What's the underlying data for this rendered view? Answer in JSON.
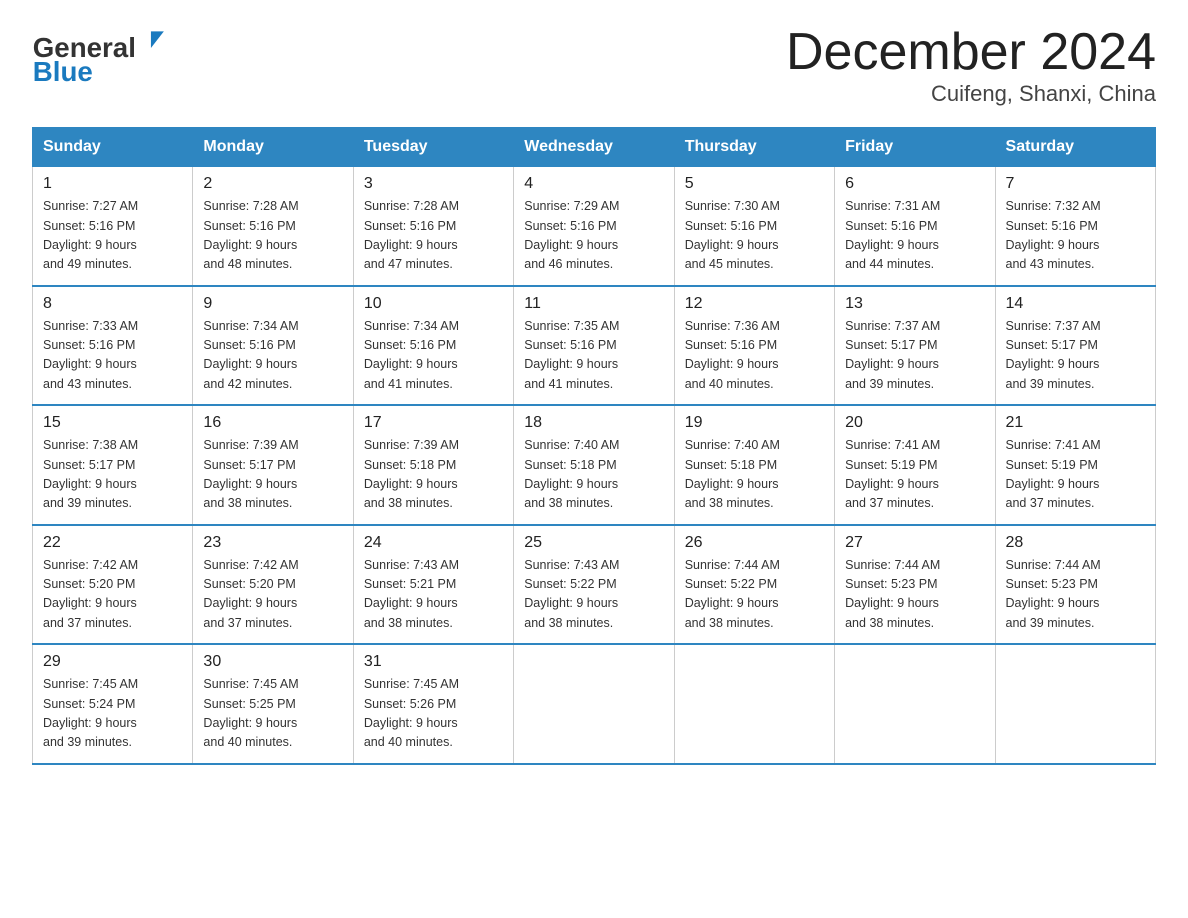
{
  "logo": {
    "general": "General",
    "blue": "Blue"
  },
  "title": "December 2024",
  "subtitle": "Cuifeng, Shanxi, China",
  "days_of_week": [
    "Sunday",
    "Monday",
    "Tuesday",
    "Wednesday",
    "Thursday",
    "Friday",
    "Saturday"
  ],
  "weeks": [
    [
      {
        "day": "1",
        "sunrise": "7:27 AM",
        "sunset": "5:16 PM",
        "daylight": "9 hours and 49 minutes."
      },
      {
        "day": "2",
        "sunrise": "7:28 AM",
        "sunset": "5:16 PM",
        "daylight": "9 hours and 48 minutes."
      },
      {
        "day": "3",
        "sunrise": "7:28 AM",
        "sunset": "5:16 PM",
        "daylight": "9 hours and 47 minutes."
      },
      {
        "day": "4",
        "sunrise": "7:29 AM",
        "sunset": "5:16 PM",
        "daylight": "9 hours and 46 minutes."
      },
      {
        "day": "5",
        "sunrise": "7:30 AM",
        "sunset": "5:16 PM",
        "daylight": "9 hours and 45 minutes."
      },
      {
        "day": "6",
        "sunrise": "7:31 AM",
        "sunset": "5:16 PM",
        "daylight": "9 hours and 44 minutes."
      },
      {
        "day": "7",
        "sunrise": "7:32 AM",
        "sunset": "5:16 PM",
        "daylight": "9 hours and 43 minutes."
      }
    ],
    [
      {
        "day": "8",
        "sunrise": "7:33 AM",
        "sunset": "5:16 PM",
        "daylight": "9 hours and 43 minutes."
      },
      {
        "day": "9",
        "sunrise": "7:34 AM",
        "sunset": "5:16 PM",
        "daylight": "9 hours and 42 minutes."
      },
      {
        "day": "10",
        "sunrise": "7:34 AM",
        "sunset": "5:16 PM",
        "daylight": "9 hours and 41 minutes."
      },
      {
        "day": "11",
        "sunrise": "7:35 AM",
        "sunset": "5:16 PM",
        "daylight": "9 hours and 41 minutes."
      },
      {
        "day": "12",
        "sunrise": "7:36 AM",
        "sunset": "5:16 PM",
        "daylight": "9 hours and 40 minutes."
      },
      {
        "day": "13",
        "sunrise": "7:37 AM",
        "sunset": "5:17 PM",
        "daylight": "9 hours and 39 minutes."
      },
      {
        "day": "14",
        "sunrise": "7:37 AM",
        "sunset": "5:17 PM",
        "daylight": "9 hours and 39 minutes."
      }
    ],
    [
      {
        "day": "15",
        "sunrise": "7:38 AM",
        "sunset": "5:17 PM",
        "daylight": "9 hours and 39 minutes."
      },
      {
        "day": "16",
        "sunrise": "7:39 AM",
        "sunset": "5:17 PM",
        "daylight": "9 hours and 38 minutes."
      },
      {
        "day": "17",
        "sunrise": "7:39 AM",
        "sunset": "5:18 PM",
        "daylight": "9 hours and 38 minutes."
      },
      {
        "day": "18",
        "sunrise": "7:40 AM",
        "sunset": "5:18 PM",
        "daylight": "9 hours and 38 minutes."
      },
      {
        "day": "19",
        "sunrise": "7:40 AM",
        "sunset": "5:18 PM",
        "daylight": "9 hours and 38 minutes."
      },
      {
        "day": "20",
        "sunrise": "7:41 AM",
        "sunset": "5:19 PM",
        "daylight": "9 hours and 37 minutes."
      },
      {
        "day": "21",
        "sunrise": "7:41 AM",
        "sunset": "5:19 PM",
        "daylight": "9 hours and 37 minutes."
      }
    ],
    [
      {
        "day": "22",
        "sunrise": "7:42 AM",
        "sunset": "5:20 PM",
        "daylight": "9 hours and 37 minutes."
      },
      {
        "day": "23",
        "sunrise": "7:42 AM",
        "sunset": "5:20 PM",
        "daylight": "9 hours and 37 minutes."
      },
      {
        "day": "24",
        "sunrise": "7:43 AM",
        "sunset": "5:21 PM",
        "daylight": "9 hours and 38 minutes."
      },
      {
        "day": "25",
        "sunrise": "7:43 AM",
        "sunset": "5:22 PM",
        "daylight": "9 hours and 38 minutes."
      },
      {
        "day": "26",
        "sunrise": "7:44 AM",
        "sunset": "5:22 PM",
        "daylight": "9 hours and 38 minutes."
      },
      {
        "day": "27",
        "sunrise": "7:44 AM",
        "sunset": "5:23 PM",
        "daylight": "9 hours and 38 minutes."
      },
      {
        "day": "28",
        "sunrise": "7:44 AM",
        "sunset": "5:23 PM",
        "daylight": "9 hours and 39 minutes."
      }
    ],
    [
      {
        "day": "29",
        "sunrise": "7:45 AM",
        "sunset": "5:24 PM",
        "daylight": "9 hours and 39 minutes."
      },
      {
        "day": "30",
        "sunrise": "7:45 AM",
        "sunset": "5:25 PM",
        "daylight": "9 hours and 40 minutes."
      },
      {
        "day": "31",
        "sunrise": "7:45 AM",
        "sunset": "5:26 PM",
        "daylight": "9 hours and 40 minutes."
      },
      null,
      null,
      null,
      null
    ]
  ]
}
